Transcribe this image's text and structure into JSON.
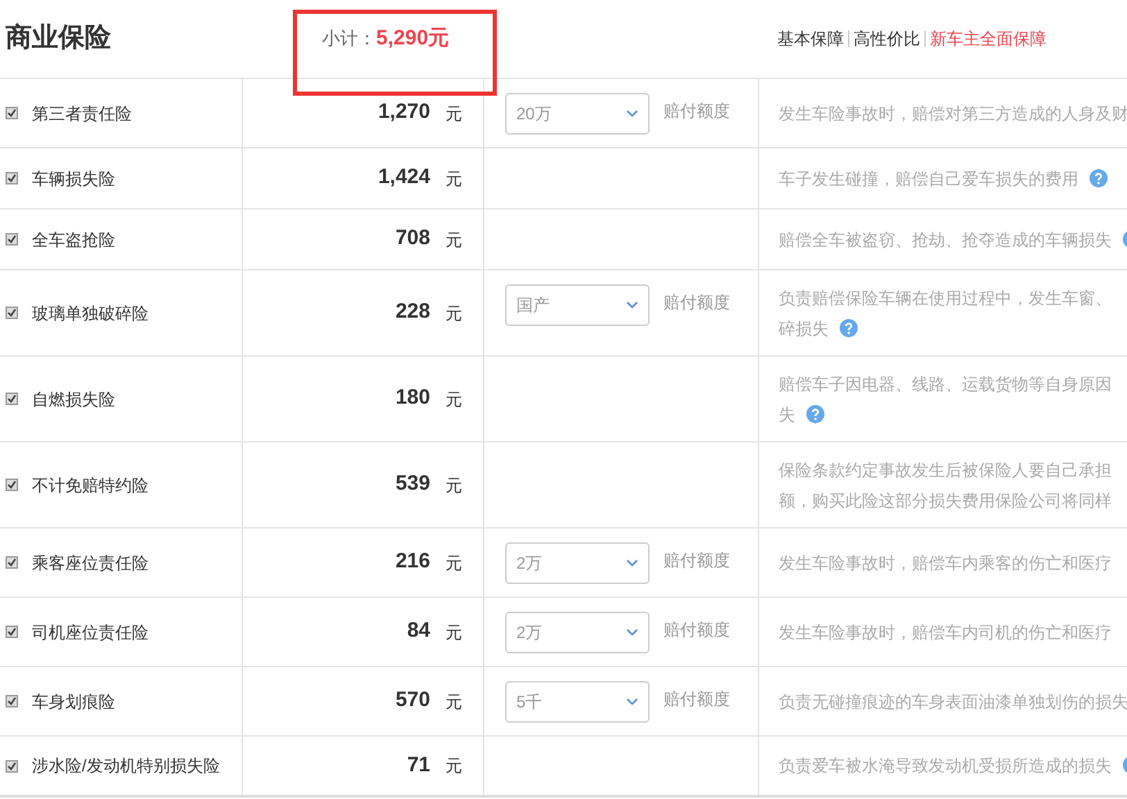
{
  "section": {
    "title": "商业保险",
    "subtotal_label": "小计：",
    "subtotal_value": "5,290元"
  },
  "plans": [
    {
      "label": "基本保障",
      "selected": false
    },
    {
      "label": "高性价比",
      "selected": false
    },
    {
      "label": "新车主全面保障",
      "selected": true
    }
  ],
  "rows": [
    {
      "name": "第三者责任险",
      "checked": true,
      "price": "1,270",
      "unit": "元",
      "select": "20万",
      "select_label": "赔付额度",
      "description": [
        "发生车险事故时，赔偿对第三方造成的人身及财"
      ],
      "help": false
    },
    {
      "name": "车辆损失险",
      "checked": true,
      "price": "1,424",
      "unit": "元",
      "description": [
        "车子发生碰撞，赔偿自己爱车损失的费用"
      ],
      "help": true
    },
    {
      "name": "全车盗抢险",
      "checked": true,
      "price": "708",
      "unit": "元",
      "description": [
        "赔偿全车被盗窃、抢劫、抢夺造成的车辆损失"
      ],
      "help": true
    },
    {
      "name": "玻璃单独破碎险",
      "checked": true,
      "price": "228",
      "unit": "元",
      "select": "国产",
      "select_label": "赔付额度",
      "description": [
        "负责赔偿保险车辆在使用过程中，发生车窗、",
        "碎损失"
      ],
      "help": true
    },
    {
      "name": "自燃损失险",
      "checked": true,
      "price": "180",
      "unit": "元",
      "description": [
        "赔偿车子因电器、线路、运载货物等自身原因",
        "失"
      ],
      "help": true
    },
    {
      "name": "不计免赔特约险",
      "checked": true,
      "price": "539",
      "unit": "元",
      "description": [
        "保险条款约定事故发生后被保险人要自己承担",
        "额，购买此险这部分损失费用保险公司将同样"
      ],
      "help": false
    },
    {
      "name": "乘客座位责任险",
      "checked": true,
      "price": "216",
      "unit": "元",
      "select": "2万",
      "select_label": "赔付额度",
      "description": [
        "发生车险事故时，赔偿车内乘客的伤亡和医疗"
      ],
      "help": false
    },
    {
      "name": "司机座位责任险",
      "checked": true,
      "price": "84",
      "unit": "元",
      "select": "2万",
      "select_label": "赔付额度",
      "description": [
        "发生车险事故时，赔偿车内司机的伤亡和医疗"
      ],
      "help": false
    },
    {
      "name": "车身划痕险",
      "checked": true,
      "price": "570",
      "unit": "元",
      "select": "5千",
      "select_label": "赔付额度",
      "description": [
        "负责无碰撞痕迹的车身表面油漆单独划伤的损失"
      ],
      "help": false
    },
    {
      "name": "涉水险/发动机特别损失险",
      "checked": true,
      "price": "71",
      "unit": "元",
      "description": [
        "负责爱车被水淹导致发动机受损所造成的损失"
      ],
      "help": true
    }
  ]
}
